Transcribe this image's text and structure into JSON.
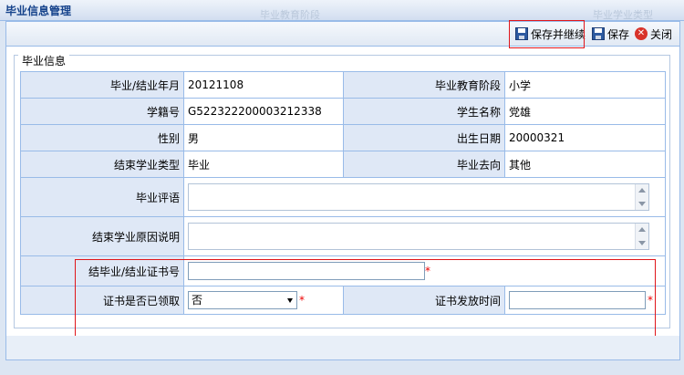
{
  "window": {
    "title": "毕业信息管理",
    "ghost_texts": [
      "毕业教育阶段",
      "毕业学业类型"
    ]
  },
  "toolbar": {
    "save_continue_label": "保存并继续",
    "save_label": "保存",
    "close_label": "关闭"
  },
  "form": {
    "legend": "毕业信息",
    "labels": {
      "grad_date": "毕业/结业年月",
      "edu_stage": "毕业教育阶段",
      "student_no": "学籍号",
      "student_name": "学生名称",
      "gender": "性别",
      "birth_date": "出生日期",
      "end_type": "结束学业类型",
      "destination": "毕业去向",
      "comment": "毕业评语",
      "end_reason": "结束学业原因说明",
      "cert_no": "结毕业/结业证书号",
      "cert_received": "证书是否已领取",
      "cert_issue_time": "证书发放时间"
    },
    "values": {
      "grad_date": "20121108",
      "edu_stage": "小学",
      "student_no": "G522322200003212338",
      "student_name": "党雄",
      "gender": "男",
      "birth_date": "20000321",
      "end_type": "毕业",
      "destination": "其他",
      "comment": "",
      "end_reason": "",
      "cert_no": "",
      "cert_received": "否",
      "cert_issue_time": ""
    },
    "required_mark": "*"
  }
}
